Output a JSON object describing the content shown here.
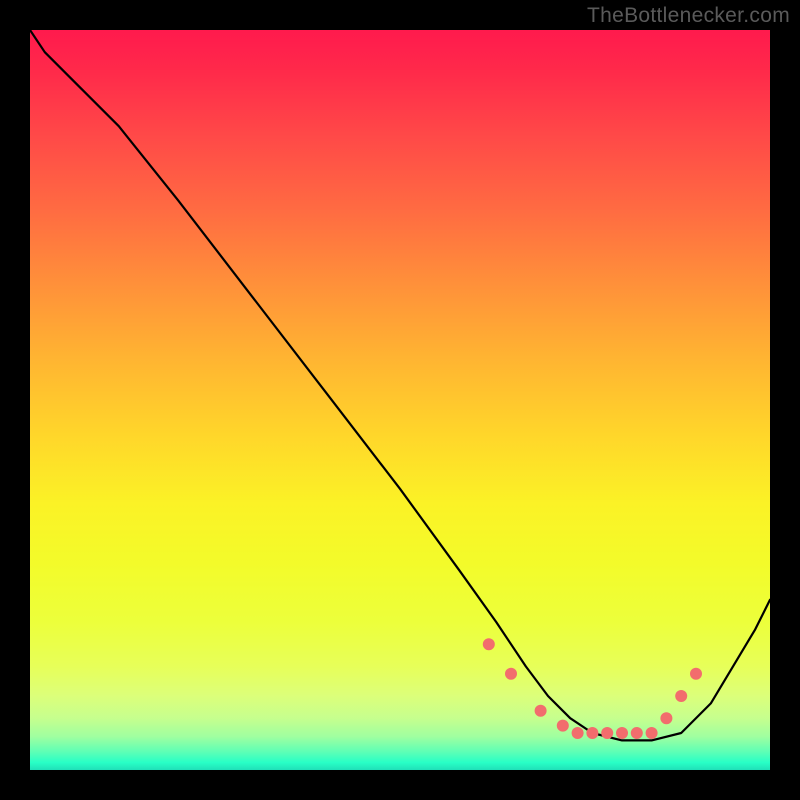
{
  "watermark": "TheBottlenecker.com",
  "chart_data": {
    "type": "line",
    "title": "",
    "xlabel": "",
    "ylabel": "",
    "xlim": [
      0,
      100
    ],
    "ylim": [
      0,
      100
    ],
    "grid": false,
    "legend": false,
    "series": [
      {
        "name": "curve",
        "x": [
          0,
          2,
          6,
          12,
          20,
          30,
          40,
          50,
          58,
          63,
          67,
          70,
          73,
          76,
          80,
          84,
          88,
          92,
          95,
          98,
          100
        ],
        "values": [
          100,
          97,
          93,
          87,
          77,
          64,
          51,
          38,
          27,
          20,
          14,
          10,
          7,
          5,
          4,
          4,
          5,
          9,
          14,
          19,
          23
        ]
      }
    ],
    "markers": {
      "name": "dots",
      "x": [
        62,
        65,
        69,
        72,
        74,
        76,
        78,
        80,
        82,
        84,
        86,
        88,
        90
      ],
      "values": [
        17,
        13,
        8,
        6,
        5,
        5,
        5,
        5,
        5,
        5,
        7,
        10,
        13
      ],
      "color": "#f26d6d",
      "radius": 6
    },
    "background_gradient": {
      "top": "#ff1a4d",
      "mid": "#fff02a",
      "bottom": "#28ffc6"
    }
  }
}
